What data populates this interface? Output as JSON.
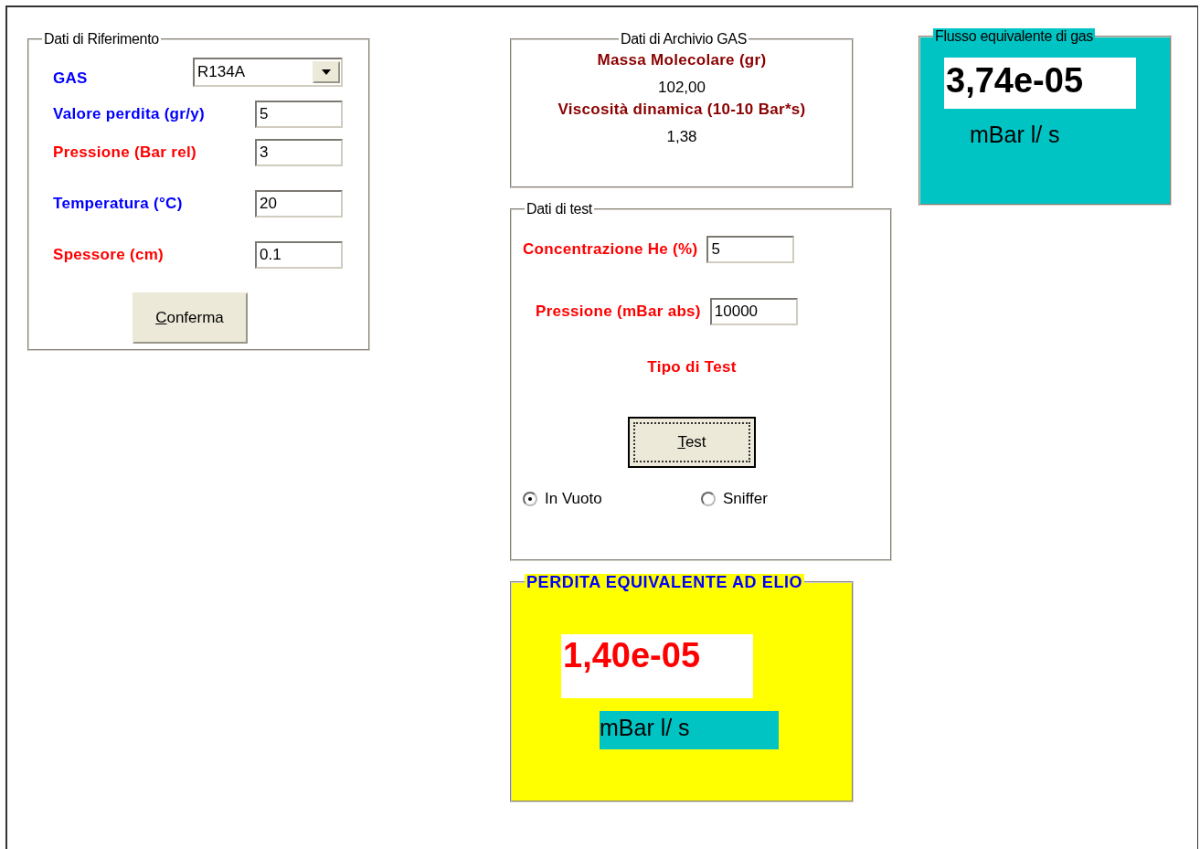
{
  "reference": {
    "title": "Dati di Riferimento",
    "gas": {
      "label": "GAS",
      "color": "#0000ff",
      "value": "R134A"
    },
    "fields": [
      {
        "label": "Valore perdita (gr/y)",
        "color": "#0000ff",
        "value": "5"
      },
      {
        "label": "Pressione (Bar rel)",
        "color": "#ff0000",
        "value": "3"
      },
      {
        "label": "Temperatura (°C)",
        "color": "#0000ff",
        "value": "20"
      },
      {
        "label": "Spessore  (cm)",
        "color": "#ff0000",
        "value": "0.1"
      }
    ],
    "button": "Conferma"
  },
  "archive": {
    "title": "Dati di Archivio GAS",
    "items": [
      {
        "label": "Massa Molecolare (gr)",
        "value": "102,00"
      },
      {
        "label": "Viscosità dinamica (10-10 Bar*s)",
        "value": "1,38"
      }
    ]
  },
  "test": {
    "title": "Dati di test",
    "fields": [
      {
        "label": "Concentrazione He (%)",
        "value": "5"
      },
      {
        "label": "Pressione (mBar abs)",
        "value": "10000"
      }
    ],
    "type_label": "Tipo di Test",
    "button": "Test",
    "options": [
      {
        "label": "In Vuoto",
        "selected": true
      },
      {
        "label": "Sniffer",
        "selected": false
      }
    ]
  },
  "helium": {
    "title": "PERDITA EQUIVALENTE AD ELIO",
    "value": "1,40e-05",
    "unit": "mBar l/ s"
  },
  "gas_flow": {
    "title": "Flusso  equivalente di gas",
    "value": "3,74e-05",
    "unit": "mBar l/ s"
  }
}
